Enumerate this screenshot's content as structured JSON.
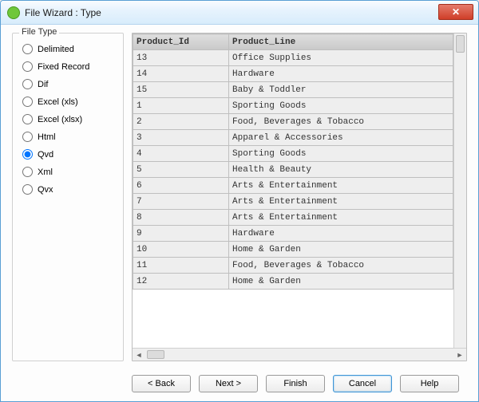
{
  "window": {
    "title": "File Wizard : Type"
  },
  "fileType": {
    "groupLabel": "File Type",
    "options": [
      {
        "value": "delimited",
        "label": "Delimited",
        "checked": false
      },
      {
        "value": "fixed",
        "label": "Fixed Record",
        "checked": false
      },
      {
        "value": "dif",
        "label": "Dif",
        "checked": false
      },
      {
        "value": "xls",
        "label": "Excel (xls)",
        "checked": false
      },
      {
        "value": "xlsx",
        "label": "Excel (xlsx)",
        "checked": false
      },
      {
        "value": "html",
        "label": "Html",
        "checked": false
      },
      {
        "value": "qvd",
        "label": "Qvd",
        "checked": true
      },
      {
        "value": "xml",
        "label": "Xml",
        "checked": false
      },
      {
        "value": "qvx",
        "label": "Qvx",
        "checked": false
      }
    ]
  },
  "table": {
    "columns": [
      "Product_Id",
      "Product_Line"
    ],
    "rows": [
      [
        "13",
        "Office Supplies"
      ],
      [
        "14",
        "Hardware"
      ],
      [
        "15",
        "Baby & Toddler"
      ],
      [
        "1",
        "Sporting Goods"
      ],
      [
        "2",
        "Food, Beverages & Tobacco"
      ],
      [
        "3",
        "Apparel & Accessories"
      ],
      [
        "4",
        "Sporting Goods"
      ],
      [
        "5",
        "Health & Beauty"
      ],
      [
        "6",
        "Arts & Entertainment"
      ],
      [
        "7",
        "Arts & Entertainment"
      ],
      [
        "8",
        "Arts & Entertainment"
      ],
      [
        "9",
        "Hardware"
      ],
      [
        "10",
        "Home & Garden"
      ],
      [
        "11",
        "Food, Beverages & Tobacco"
      ],
      [
        "12",
        "Home & Garden"
      ]
    ]
  },
  "buttons": {
    "back": "< Back",
    "next": "Next >",
    "finish": "Finish",
    "cancel": "Cancel",
    "help": "Help"
  },
  "close_glyph": "✕"
}
